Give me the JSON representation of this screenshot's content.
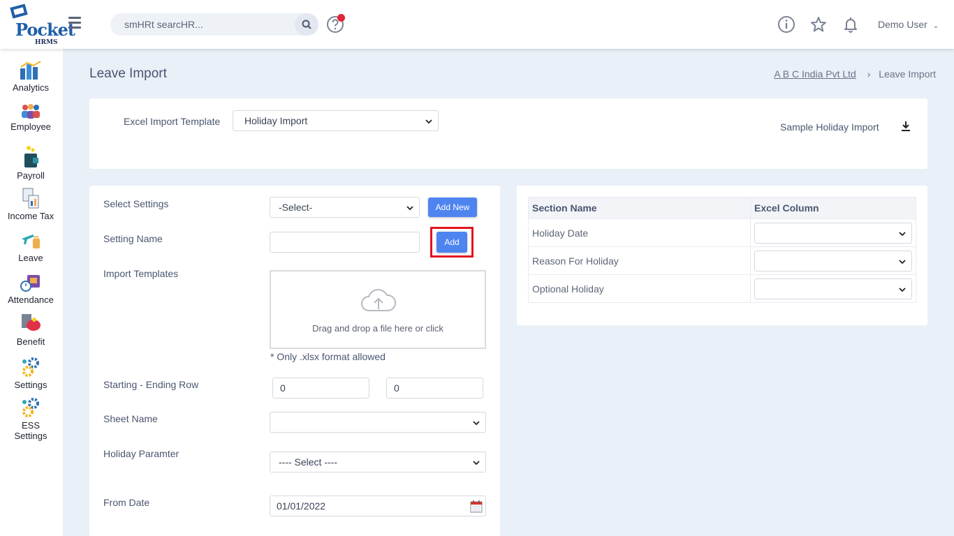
{
  "header": {
    "logo_text": "Pocket",
    "logo_sub": "HRMS",
    "search_placeholder": "smHRt searcHR...",
    "user_name": "Demo User"
  },
  "sidebar": {
    "items": [
      {
        "label": "Analytics",
        "icon": "analytics-icon"
      },
      {
        "label": "Employee",
        "icon": "employee-icon"
      },
      {
        "label": "Payroll",
        "icon": "payroll-icon"
      },
      {
        "label": "Income Tax",
        "icon": "income-tax-icon"
      },
      {
        "label": "Leave",
        "icon": "leave-icon"
      },
      {
        "label": "Attendance",
        "icon": "attendance-icon"
      },
      {
        "label": "Benefit",
        "icon": "benefit-icon"
      },
      {
        "label": "Settings",
        "icon": "settings-icon"
      },
      {
        "label_line1": "ESS",
        "label_line2": "Settings",
        "icon": "ess-settings-icon"
      }
    ]
  },
  "page": {
    "title": "Leave Import",
    "breadcrumb_company": "A B C India Pvt Ltd",
    "breadcrumb_current": "Leave Import"
  },
  "template_card": {
    "label": "Excel Import Template",
    "selected": "Holiday Import",
    "sample_link": "Sample Holiday Import"
  },
  "form": {
    "select_settings_label": "Select Settings",
    "select_settings_value": "-Select-",
    "add_new_label": "Add New",
    "setting_name_label": "Setting Name",
    "setting_name_value": "",
    "add_label": "Add",
    "import_templates_label": "Import Templates",
    "dropzone_text": "Drag and drop a file here or click",
    "format_hint": "* Only .xlsx format allowed",
    "rows_label": "Starting - Ending Row",
    "start_row": "0",
    "end_row": "0",
    "sheet_name_label": "Sheet Name",
    "sheet_name_value": "",
    "holiday_param_label": "Holiday Paramter",
    "holiday_param_value": "---- Select ----",
    "from_date_label": "From Date",
    "from_date_value": "01/01/2022"
  },
  "mapping": {
    "col_section": "Section Name",
    "col_excel": "Excel Column",
    "rows": [
      {
        "name": "Holiday Date",
        "value": ""
      },
      {
        "name": "Reason For Holiday",
        "value": ""
      },
      {
        "name": "Optional Holiday",
        "value": ""
      }
    ]
  },
  "colors": {
    "accent": "#4e84f0",
    "highlight": "#e0141e",
    "background": "#eaf0f8"
  }
}
